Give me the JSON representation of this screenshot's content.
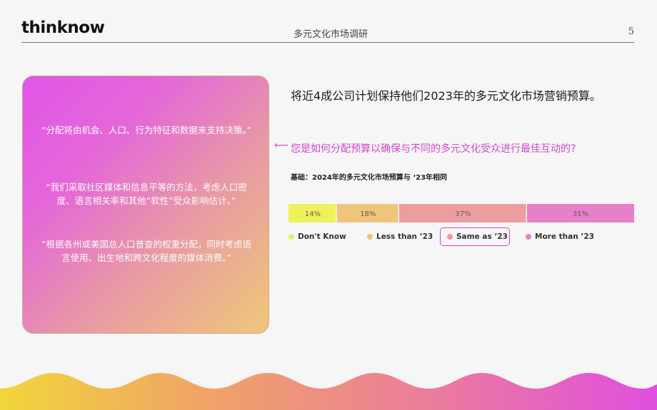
{
  "header": {
    "logo": "thinknow",
    "title": "多元文化市场调研",
    "page_number": "5"
  },
  "card": {
    "quotes": [
      "“分配将由机会、人口、行为特征和数据来支持决策。”",
      "“我们采取社区媒体和信息平等的方法，考虑人口密度、语言相关率和其他“软性”受众影响估计。”",
      "“根据各州或美国总人口普查的权重分配，同时考虑语言使用、出生地和跨文化程度的媒体消费。”"
    ]
  },
  "main": {
    "headline": "将近4成公司计划保持他们2023年的多元文化市场营销预算。",
    "arrow": "⟵",
    "question": "您是如何分配预算以确保与不同的多元文化受众进行最佳互动的?",
    "basis": "基础：2024年的多元文化市场预算与 ‘23年相同"
  },
  "chart_data": {
    "type": "bar",
    "orientation": "horizontal-stacked-100",
    "categories": [
      "Don't Know",
      "Less than '23",
      "Same as '23",
      "More than '23"
    ],
    "values": [
      14,
      18,
      37,
      31
    ],
    "labels": [
      "14%",
      "18%",
      "37%",
      "31%"
    ],
    "colors": [
      "#eef25a",
      "#efc47c",
      "#eb9da0",
      "#e581c8"
    ],
    "legend": [
      "Don't Know",
      "Less than ’23",
      "Same as ’23",
      "More than ’23"
    ],
    "legend_placement": "bottom",
    "highlighted": "Same as ’23",
    "highlight_color": "#d245d0",
    "xlim": [
      0,
      100
    ]
  }
}
